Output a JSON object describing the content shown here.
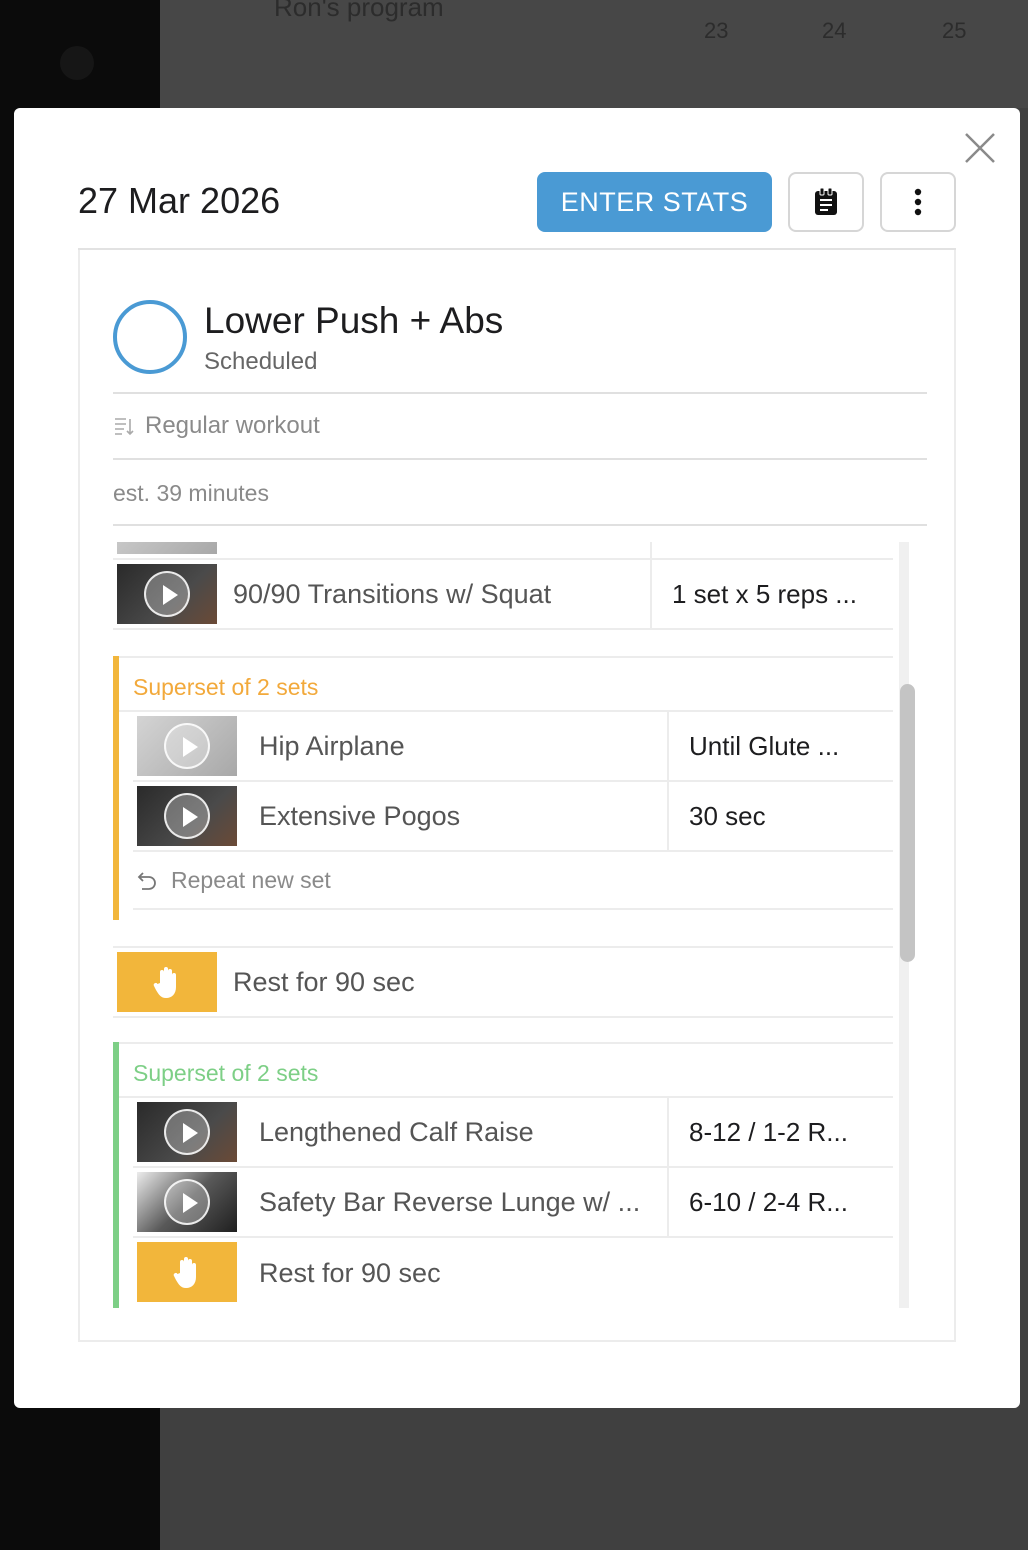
{
  "background": {
    "program_label": "Ron's program",
    "days": [
      "23",
      "24",
      "25"
    ]
  },
  "modal": {
    "date": "27 Mar 2026",
    "enter_stats_label": "ENTER STATS",
    "workout": {
      "title": "Lower Push + Abs",
      "status": "Scheduled",
      "type": "Regular workout",
      "estimate": "est. 39 minutes"
    },
    "exercises": {
      "transitions": {
        "name": "90/90 Transitions w/ Squat",
        "sets": "1 set x 5 reps ..."
      },
      "superset_1": {
        "label": "Superset of 2 sets",
        "items": [
          {
            "name": "Hip Airplane",
            "sets": "Until Glute ..."
          },
          {
            "name": "Extensive Pogos",
            "sets": "30 sec"
          }
        ],
        "repeat_label": "Repeat new set"
      },
      "rest_1": "Rest for 90 sec",
      "superset_2": {
        "label": "Superset of 2 sets",
        "items": [
          {
            "name": "Lengthened Calf Raise",
            "sets": "8-12 / 1-2 R..."
          },
          {
            "name": "Safety Bar Reverse Lunge w/ ...",
            "sets": "6-10 / 2-4 R..."
          }
        ],
        "rest": "Rest for 90 sec"
      }
    }
  },
  "colors": {
    "accent": "#4a9ad4",
    "superset_orange": "#f2b63b",
    "superset_green": "#7dcf86"
  }
}
